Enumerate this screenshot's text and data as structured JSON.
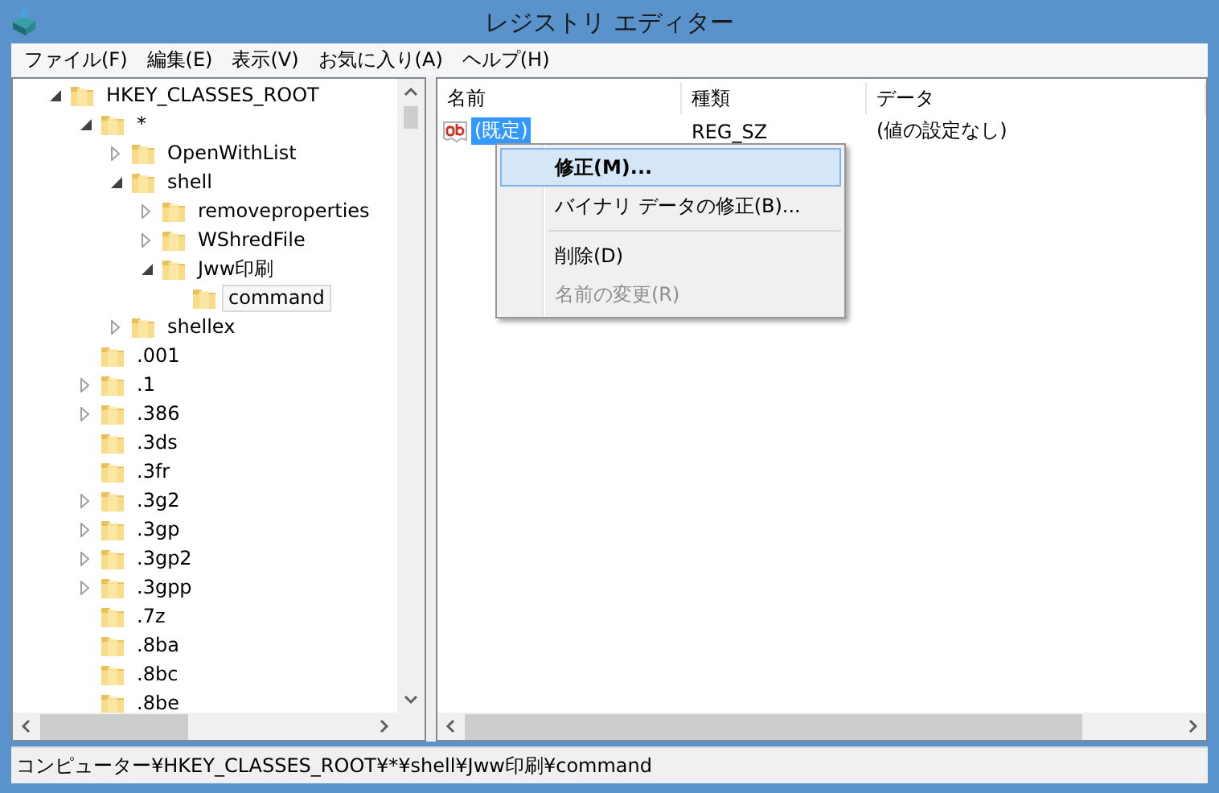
{
  "window": {
    "title": "レジストリ エディター"
  },
  "menu_bar": [
    "ファイル(F)",
    "編集(E)",
    "表示(V)",
    "お気に入り(A)",
    "ヘルプ(H)"
  ],
  "tree": [
    {
      "label": "HKEY_CLASSES_ROOT",
      "expanded": true,
      "selected": false,
      "children": [
        {
          "label": "*",
          "expanded": true,
          "selected": false,
          "children": [
            {
              "label": "OpenWithList",
              "expanded": false,
              "selected": false
            },
            {
              "label": "shell",
              "expanded": true,
              "selected": false,
              "children": [
                {
                  "label": "removeproperties",
                  "expanded": false,
                  "selected": false
                },
                {
                  "label": "WShredFile",
                  "expanded": false,
                  "selected": false
                },
                {
                  "label": "Jww印刷",
                  "expanded": true,
                  "selected": false,
                  "children": [
                    {
                      "label": "command",
                      "selected": true
                    }
                  ]
                }
              ]
            },
            {
              "label": "shellex",
              "expanded": false,
              "selected": false
            }
          ]
        },
        {
          "label": ".001",
          "selected": false
        },
        {
          "label": ".1",
          "expanded": false,
          "selected": false
        },
        {
          "label": ".386",
          "expanded": false,
          "selected": false
        },
        {
          "label": ".3ds",
          "selected": false
        },
        {
          "label": ".3fr",
          "selected": false
        },
        {
          "label": ".3g2",
          "expanded": false,
          "selected": false
        },
        {
          "label": ".3gp",
          "expanded": false,
          "selected": false
        },
        {
          "label": ".3gp2",
          "expanded": false,
          "selected": false
        },
        {
          "label": ".3gpp",
          "expanded": false,
          "selected": false
        },
        {
          "label": ".7z",
          "selected": false
        },
        {
          "label": ".8ba",
          "selected": false
        },
        {
          "label": ".8bc",
          "selected": false
        },
        {
          "label": ".8be",
          "selected": false
        }
      ]
    }
  ],
  "list": {
    "columns": [
      "名前",
      "種類",
      "データ"
    ],
    "rows": [
      {
        "name": "(既定)",
        "type": "REG_SZ",
        "data": "(値の設定なし)",
        "selected": true
      }
    ]
  },
  "context_menu": [
    {
      "kind": "item",
      "label": "修正(M)...",
      "selected": true,
      "disabled": false,
      "bold": true
    },
    {
      "kind": "item",
      "label": "バイナリ データの修正(B)...",
      "selected": false,
      "disabled": false,
      "bold": false
    },
    {
      "kind": "separator"
    },
    {
      "kind": "item",
      "label": "削除(D)",
      "selected": false,
      "disabled": false,
      "bold": false
    },
    {
      "kind": "item",
      "label": "名前の変更(R)",
      "selected": false,
      "disabled": true,
      "bold": false
    }
  ],
  "status_bar": "コンピューター¥HKEY_CLASSES_ROOT¥*¥shell¥Jww印刷¥command"
}
